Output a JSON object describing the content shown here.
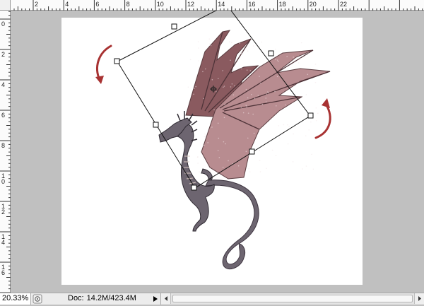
{
  "rulers": {
    "horizontal_labels": [
      "2",
      "4",
      "6",
      "8",
      "10",
      "12",
      "14",
      "16",
      "18",
      "20",
      "22"
    ],
    "vertical_labels": [
      "0",
      "2",
      "4",
      "6",
      "8",
      "10",
      "12",
      "14",
      "16"
    ]
  },
  "canvas": {
    "rotate_left_arrow_color": "#a83232",
    "rotate_right_arrow_color": "#a83232",
    "wing_color": "#8a5a5f",
    "wing_membrane_color": "#b88c90",
    "body_color": "#6d6570"
  },
  "status_bar": {
    "zoom_value": "20.33%",
    "doc_label": "Doc:",
    "doc_size": "14.2M/423.4M"
  },
  "icons": {
    "preview": "page-preview-icon",
    "menu_arrow": "triangle-right-icon",
    "scroll_left": "scroll-left-arrow-icon",
    "scroll_right": "scroll-right-arrow-icon"
  }
}
